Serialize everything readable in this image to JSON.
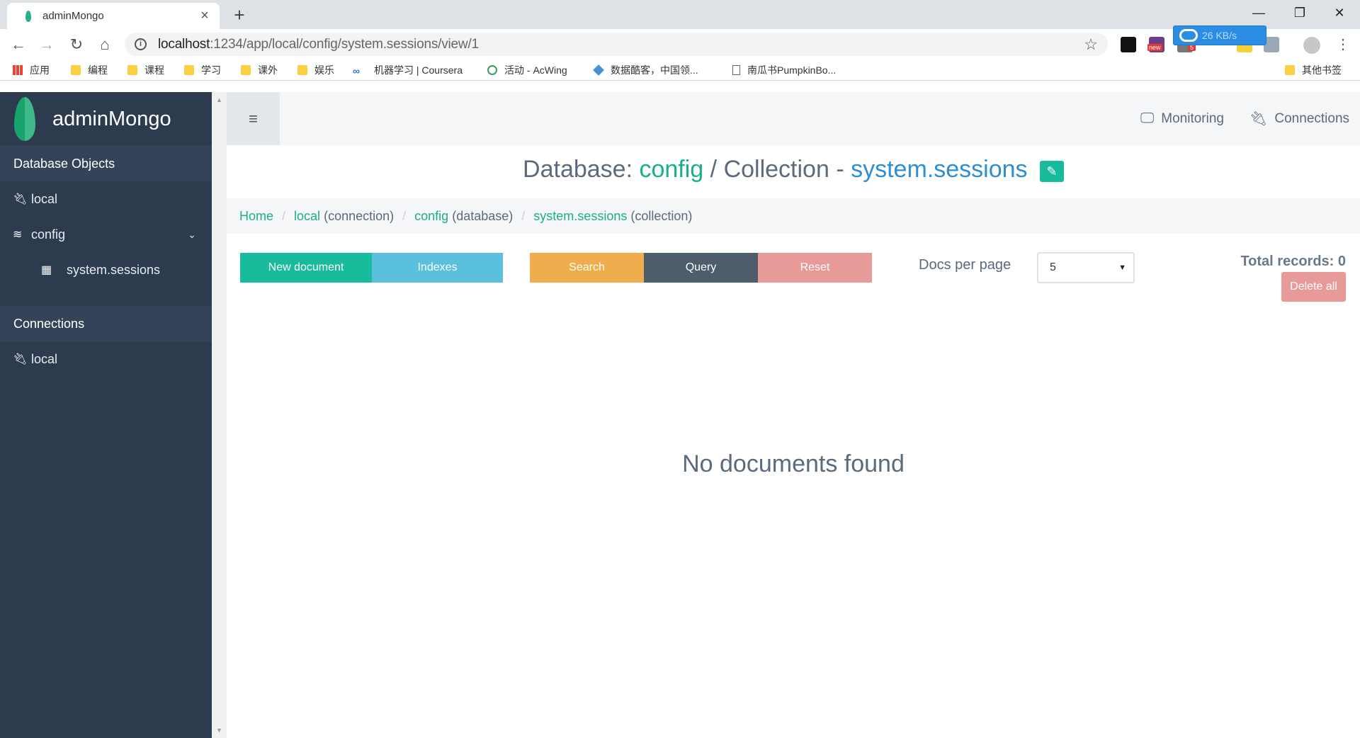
{
  "browser": {
    "tab_title": "adminMongo",
    "url_host": "localhost",
    "url_path": ":1234/app/local/config/system.sessions/view/1",
    "speed": "26 KB/s",
    "ext_badge_new": "new",
    "ext_badge_count": "5",
    "bookmarks": [
      {
        "label": "应用",
        "icon": "apps-grid-icon"
      },
      {
        "label": "编程",
        "icon": "folder-icon"
      },
      {
        "label": "课程",
        "icon": "folder-icon"
      },
      {
        "label": "学习",
        "icon": "folder-icon"
      },
      {
        "label": "课外",
        "icon": "folder-icon"
      },
      {
        "label": "娱乐",
        "icon": "folder-icon"
      },
      {
        "label": "机器学习 | Coursera",
        "icon": "coursera-icon"
      },
      {
        "label": "活动 - AcWing",
        "icon": "acwing-icon"
      },
      {
        "label": "数据酷客，中国领...",
        "icon": "cookdata-icon"
      },
      {
        "label": "南瓜书PumpkinBo...",
        "icon": "page-icon"
      }
    ],
    "other_bookmarks": "其他书签"
  },
  "sidebar": {
    "app_name": "adminMongo",
    "db_header": "Database Objects",
    "db_items": [
      {
        "label": "local",
        "icon": "plug-icon"
      },
      {
        "label": "config",
        "icon": "database-icon"
      },
      {
        "label": "system.sessions",
        "icon": "table-icon"
      }
    ],
    "conn_header": "Connections",
    "conn_items": [
      {
        "label": "local",
        "icon": "plug-icon"
      }
    ]
  },
  "topnav": {
    "monitoring": "Monitoring",
    "connections": "Connections"
  },
  "title": {
    "db_prefix": "Database:",
    "db_name": "config",
    "slash": "/",
    "coll_prefix": "Collection -",
    "coll_name": "system.sessions"
  },
  "breadcrumb": {
    "home": "Home",
    "conn_name": "local",
    "conn_type": "(connection)",
    "db_name": "config",
    "db_type": "(database)",
    "coll_name": "system.sessions",
    "coll_type": "(collection)",
    "sep": "/"
  },
  "toolbar": {
    "new_document": "New document",
    "indexes": "Indexes",
    "search": "Search",
    "query": "Query",
    "reset": "Reset",
    "docs_per_page_label": "Docs per page",
    "docs_per_page_value": "5",
    "total_records": "Total records: 0",
    "delete_all": "Delete all"
  },
  "main": {
    "empty_message": "No documents found"
  },
  "colors": {
    "sidebar_bg": "#2d3b4f",
    "green": "#18bc9c",
    "blue": "#5bc0de",
    "orange": "#f0ad4e",
    "slate": "#4e5d6c",
    "red": "#e79a98"
  }
}
